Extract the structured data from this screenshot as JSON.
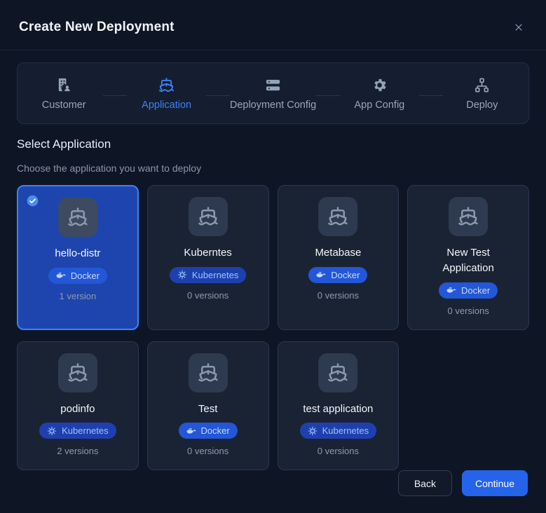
{
  "colors": {
    "bg": "#0e1626",
    "panel": "#151e30",
    "panel-border": "#232e44",
    "card-bg": "#1a2334",
    "card-border": "#2b3750",
    "tile-bg": "#2e3a4f",
    "muted": "#94a3b8",
    "text": "#f1f5f9",
    "accent": "#3b82f6",
    "selected-bg": "#1e45ae",
    "k8s-bg": "#1e40af",
    "k8s-text": "#9cc3fd",
    "docker-bg": "#2357d7",
    "docker-text": "#c3d9fd",
    "continue-bg": "#2563eb"
  },
  "header": {
    "title": "Create New Deployment",
    "close_icon": "close-icon"
  },
  "stepper": {
    "steps": [
      {
        "label": "Customer",
        "icon": "building-user-icon",
        "active": false
      },
      {
        "label": "Application",
        "icon": "ship-icon",
        "active": true
      },
      {
        "label": "Deployment Config",
        "icon": "server-icon",
        "active": false
      },
      {
        "label": "App Config",
        "icon": "gear-icon",
        "active": false
      },
      {
        "label": "Deploy",
        "icon": "sitemap-icon",
        "active": false
      }
    ]
  },
  "section": {
    "title": "Select Application",
    "subtitle": "Choose the application you want to deploy"
  },
  "cards": [
    {
      "name": "hello-distr",
      "runtime": "Docker",
      "runtime_icon": "docker-whale-icon",
      "versions": "1 version",
      "selected": true
    },
    {
      "name": "Kuberntes",
      "runtime": "Kubernetes",
      "runtime_icon": "kubernetes-helm-icon",
      "versions": "0 versions",
      "selected": false
    },
    {
      "name": "Metabase",
      "runtime": "Docker",
      "runtime_icon": "docker-whale-icon",
      "versions": "0 versions",
      "selected": false
    },
    {
      "name": "New Test Application",
      "runtime": "Docker",
      "runtime_icon": "docker-whale-icon",
      "versions": "0 versions",
      "selected": false
    },
    {
      "name": "podinfo",
      "runtime": "Kubernetes",
      "runtime_icon": "kubernetes-helm-icon",
      "versions": "2 versions",
      "selected": false
    },
    {
      "name": "Test",
      "runtime": "Docker",
      "runtime_icon": "docker-whale-icon",
      "versions": "0 versions",
      "selected": false
    },
    {
      "name": "test application",
      "runtime": "Kubernetes",
      "runtime_icon": "kubernetes-helm-icon",
      "versions": "0 versions",
      "selected": false
    }
  ],
  "footer": {
    "back_label": "Back",
    "continue_label": "Continue"
  }
}
